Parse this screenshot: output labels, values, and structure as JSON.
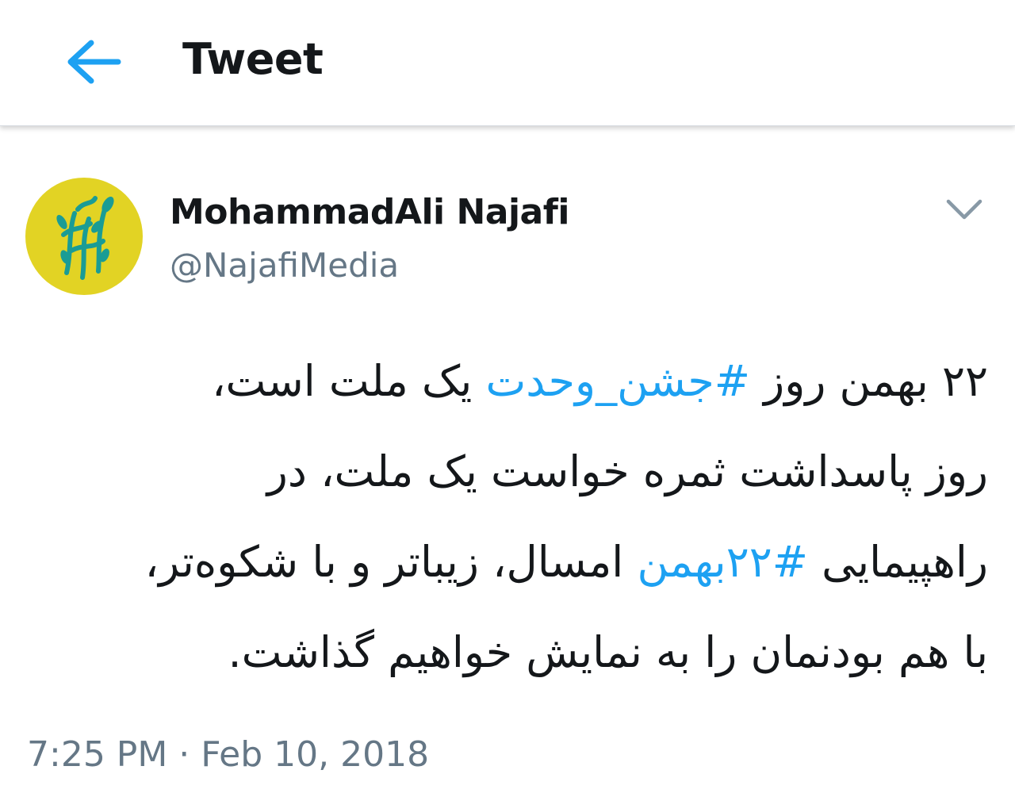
{
  "header": {
    "back_icon": "arrow-left-icon",
    "title": "Tweet"
  },
  "colors": {
    "accent": "#1da1f2",
    "avatar_bg": "#e2d324",
    "avatar_fg": "#1a9c95",
    "secondary_text": "#657786"
  },
  "tweet": {
    "author": {
      "display_name": "MohammadAli Najafi",
      "handle": "@NajafiMedia",
      "avatar_icon": "avatar-logo-icon"
    },
    "menu_icon": "chevron-down-icon",
    "text_lines": [
      [
        {
          "text": "۲۲ بهمن روز ",
          "type": "text"
        },
        {
          "text": "#جشن_وحدت",
          "type": "hashtag"
        },
        {
          "text": " یک ملت است،",
          "type": "text"
        }
      ],
      [
        {
          "text": "روز پاسداشت ثمره خواست یک ملت، در",
          "type": "text"
        }
      ],
      [
        {
          "text": "راهپیمایی ",
          "type": "text"
        },
        {
          "text": "#۲۲بهمن",
          "type": "hashtag"
        },
        {
          "text": " امسال، زیباتر و با شکوه‌تر،",
          "type": "text"
        }
      ],
      [
        {
          "text": "با هم بودنمان را به نمایش خواهیم گذاشت.",
          "type": "text"
        }
      ]
    ],
    "timestamp": "7:25 PM · Feb 10, 2018"
  }
}
